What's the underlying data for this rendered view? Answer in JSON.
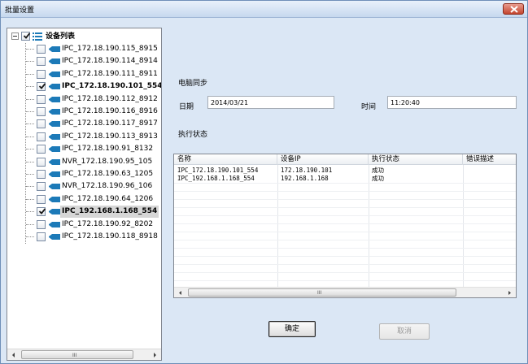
{
  "window": {
    "title": "批量设置"
  },
  "tree": {
    "root_label": "设备列表",
    "items": [
      {
        "label": "IPC_172.18.190.115_8915",
        "checked": false,
        "bold": false
      },
      {
        "label": "IPC_172.18.190.114_8914",
        "checked": false,
        "bold": false
      },
      {
        "label": "IPC_172.18.190.111_8911",
        "checked": false,
        "bold": false
      },
      {
        "label": "IPC_172.18.190.101_554",
        "checked": true,
        "bold": true
      },
      {
        "label": "IPC_172.18.190.112_8912",
        "checked": false,
        "bold": false
      },
      {
        "label": "IPC_172.18.190.116_8916",
        "checked": false,
        "bold": false
      },
      {
        "label": "IPC_172.18.190.117_8917",
        "checked": false,
        "bold": false
      },
      {
        "label": "IPC_172.18.190.113_8913",
        "checked": false,
        "bold": false
      },
      {
        "label": "IPC_172.18.190.91_8132",
        "checked": false,
        "bold": false
      },
      {
        "label": "NVR_172.18.190.95_105",
        "checked": false,
        "bold": false
      },
      {
        "label": "IPC_172.18.190.63_1205",
        "checked": false,
        "bold": false
      },
      {
        "label": "NVR_172.18.190.96_106",
        "checked": false,
        "bold": false
      },
      {
        "label": "IPC_172.18.190.64_1206",
        "checked": false,
        "bold": false
      },
      {
        "label": "IPC_192.168.1.168_554",
        "checked": true,
        "bold": true,
        "selected": true
      },
      {
        "label": "IPC_172.18.190.92_8202",
        "checked": false,
        "bold": false
      },
      {
        "label": "IPC_172.18.190.118_8918",
        "checked": false,
        "bold": false
      }
    ],
    "scroll_grip": "III"
  },
  "sync": {
    "section_label": "电脑同步",
    "date_label": "日期",
    "date_value": "2014/03/21",
    "time_label": "时间",
    "time_value": "11:20:40"
  },
  "status": {
    "section_label": "执行状态",
    "columns": [
      "名称",
      "设备IP",
      "执行状态",
      "错误描述"
    ],
    "rows": [
      [
        "IPC_172.18.190.101_554",
        "172.18.190.101",
        "成功",
        ""
      ],
      [
        "IPC_192.168.1.168_554",
        "192.168.1.168",
        "成功",
        ""
      ]
    ],
    "scroll_grip": "III"
  },
  "buttons": {
    "ok_label": "确定",
    "cancel_label": "取消"
  },
  "colors": {
    "window_bg": "#dbe7f5",
    "camera_icon": "#1c7ab8",
    "check_mark": "#1a1a1a",
    "close_button": "#c4452e"
  },
  "icons": {
    "tree_root": "list-icon",
    "tree_item": "camera-icon",
    "close": "close-icon"
  }
}
